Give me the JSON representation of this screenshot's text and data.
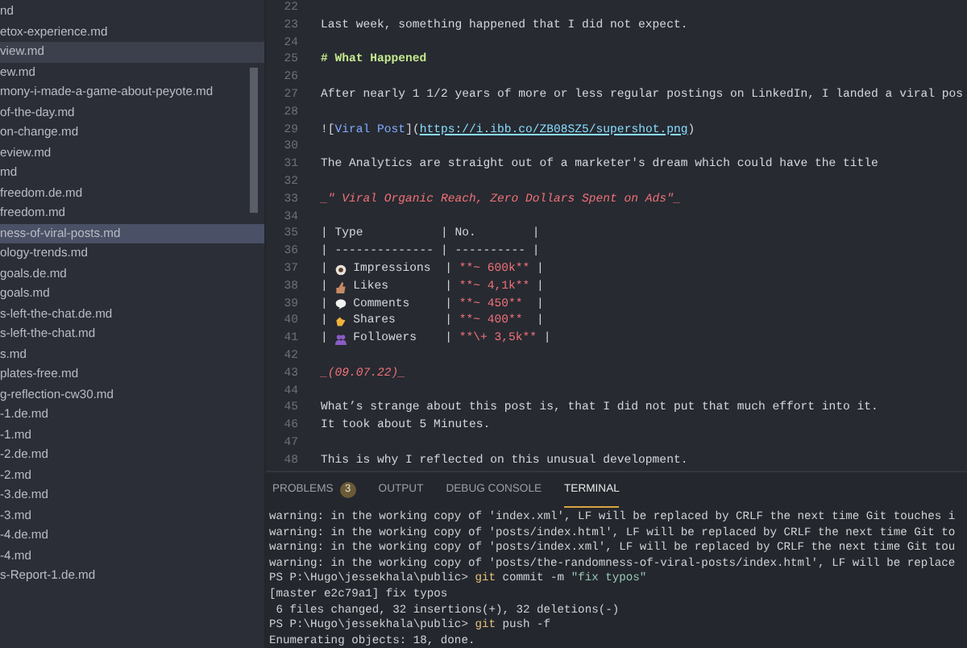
{
  "explorer": {
    "files": [
      {
        "name": "nd",
        "selected": false,
        "hovered": false
      },
      {
        "name": "etox-experience.md",
        "selected": false,
        "hovered": false
      },
      {
        "name": "view.md",
        "selected": false,
        "hovered": true
      },
      {
        "name": "ew.md",
        "selected": false,
        "hovered": false
      },
      {
        "name": "mony-i-made-a-game-about-peyote.md",
        "selected": false,
        "hovered": false
      },
      {
        "name": "of-the-day.md",
        "selected": false,
        "hovered": false
      },
      {
        "name": "on-change.md",
        "selected": false,
        "hovered": false
      },
      {
        "name": "eview.md",
        "selected": false,
        "hovered": false
      },
      {
        "name": "md",
        "selected": false,
        "hovered": false
      },
      {
        "name": "freedom.de.md",
        "selected": false,
        "hovered": false
      },
      {
        "name": "freedom.md",
        "selected": false,
        "hovered": false
      },
      {
        "name": "ness-of-viral-posts.md",
        "selected": true,
        "hovered": false
      },
      {
        "name": "ology-trends.md",
        "selected": false,
        "hovered": false
      },
      {
        "name": "goals.de.md",
        "selected": false,
        "hovered": false
      },
      {
        "name": "goals.md",
        "selected": false,
        "hovered": false
      },
      {
        "name": "s-left-the-chat.de.md",
        "selected": false,
        "hovered": false
      },
      {
        "name": "s-left-the-chat.md",
        "selected": false,
        "hovered": false
      },
      {
        "name": "s.md",
        "selected": false,
        "hovered": false
      },
      {
        "name": "plates-free.md",
        "selected": false,
        "hovered": false
      },
      {
        "name": "g-reflection-cw30.md",
        "selected": false,
        "hovered": false
      },
      {
        "name": "-1.de.md",
        "selected": false,
        "hovered": false
      },
      {
        "name": "-1.md",
        "selected": false,
        "hovered": false
      },
      {
        "name": "-2.de.md",
        "selected": false,
        "hovered": false
      },
      {
        "name": "-2.md",
        "selected": false,
        "hovered": false
      },
      {
        "name": "-3.de.md",
        "selected": false,
        "hovered": false
      },
      {
        "name": "-3.md",
        "selected": false,
        "hovered": false
      },
      {
        "name": "-4.de.md",
        "selected": false,
        "hovered": false
      },
      {
        "name": "-4.md",
        "selected": false,
        "hovered": false
      },
      {
        "name": "s-Report-1.de.md",
        "selected": false,
        "hovered": false
      }
    ]
  },
  "editor": {
    "lines": [
      {
        "number": "22"
      },
      {
        "number": "23",
        "segments": [
          {
            "kind": "plain",
            "text": "Last week, something happened that I did not expect."
          }
        ]
      },
      {
        "number": "24"
      },
      {
        "number": "25",
        "segments": [
          {
            "kind": "heading",
            "text": "# What Happened"
          }
        ]
      },
      {
        "number": "26"
      },
      {
        "number": "27",
        "segments": [
          {
            "kind": "plain",
            "text": "After nearly 1 1/2 years of more or less regular postings on LinkedIn, I landed a viral pos"
          }
        ]
      },
      {
        "number": "28"
      },
      {
        "number": "29",
        "segments": [
          {
            "kind": "plain",
            "text": "!["
          },
          {
            "kind": "link",
            "text": "Viral Post"
          },
          {
            "kind": "plain",
            "text": "]("
          },
          {
            "kind": "url",
            "text": "https://i.ibb.co/ZB08SZ5/supershot.png"
          },
          {
            "kind": "plain",
            "text": ")"
          }
        ]
      },
      {
        "number": "30"
      },
      {
        "number": "31",
        "segments": [
          {
            "kind": "plain",
            "text": "The Analytics are straight out of a marketer's dream which could have the title"
          }
        ]
      },
      {
        "number": "32"
      },
      {
        "number": "33",
        "segments": [
          {
            "kind": "emph",
            "text": "_\" Viral Organic Reach, Zero Dollars Spent on Ads\"_"
          }
        ]
      },
      {
        "number": "34"
      },
      {
        "number": "35",
        "segments": [
          {
            "kind": "plain",
            "text": "| Type           | No.        |"
          }
        ]
      },
      {
        "number": "36",
        "segments": [
          {
            "kind": "plain",
            "text": "| -------------- | ---------- |"
          }
        ]
      },
      {
        "number": "37",
        "segments": [
          {
            "kind": "plain",
            "text": "| "
          },
          {
            "kind": "icon"
          },
          {
            "kind": "plain",
            "text": " Impressions  | "
          },
          {
            "kind": "bold",
            "text": "**~ 600k**"
          },
          {
            "kind": "plain",
            "text": " |"
          }
        ]
      },
      {
        "number": "38",
        "segments": [
          {
            "kind": "plain",
            "text": "| "
          },
          {
            "kind": "icon"
          },
          {
            "kind": "plain",
            "text": " Likes        | "
          },
          {
            "kind": "bold",
            "text": "**~ 4,1k**"
          },
          {
            "kind": "plain",
            "text": " |"
          }
        ]
      },
      {
        "number": "39",
        "segments": [
          {
            "kind": "plain",
            "text": "| "
          },
          {
            "kind": "icon"
          },
          {
            "kind": "plain",
            "text": " Comments     | "
          },
          {
            "kind": "bold",
            "text": "**~ 450**"
          },
          {
            "kind": "plain",
            "text": "  |"
          }
        ]
      },
      {
        "number": "40",
        "segments": [
          {
            "kind": "plain",
            "text": "| "
          },
          {
            "kind": "icon"
          },
          {
            "kind": "plain",
            "text": " Shares       | "
          },
          {
            "kind": "bold",
            "text": "**~ 400**"
          },
          {
            "kind": "plain",
            "text": "  |"
          }
        ]
      },
      {
        "number": "41",
        "segments": [
          {
            "kind": "plain",
            "text": "| "
          },
          {
            "kind": "icon"
          },
          {
            "kind": "plain",
            "text": " Followers    | "
          },
          {
            "kind": "bold",
            "text": "**\\+ 3,5k**"
          },
          {
            "kind": "plain",
            "text": " |"
          }
        ]
      },
      {
        "number": "42"
      },
      {
        "number": "43",
        "segments": [
          {
            "kind": "emph",
            "text": "_(09.07.22)_"
          }
        ]
      },
      {
        "number": "44"
      },
      {
        "number": "45",
        "segments": [
          {
            "kind": "plain",
            "text": "What’s strange about this post is, that I did not put that much effort into it."
          }
        ]
      },
      {
        "number": "46",
        "segments": [
          {
            "kind": "plain",
            "text": "It took about 5 Minutes."
          }
        ]
      },
      {
        "number": "47"
      },
      {
        "number": "48",
        "segments": [
          {
            "kind": "plain",
            "text": "This is why I reflected on this unusual development."
          }
        ]
      }
    ]
  },
  "panel": {
    "tabs": [
      {
        "label": "PROBLEMS",
        "badge": "3",
        "selected": false
      },
      {
        "label": "OUTPUT",
        "selected": false
      },
      {
        "label": "DEBUG CONSOLE",
        "selected": false
      },
      {
        "label": "TERMINAL",
        "selected": true
      }
    ],
    "terminal": [
      [
        {
          "kind": "plain",
          "text": "warning: in the working copy of 'index.xml', LF will be replaced by CRLF the next time Git touches i"
        }
      ],
      [
        {
          "kind": "plain",
          "text": "warning: in the working copy of 'posts/index.html', LF will be replaced by CRLF the next time Git to"
        }
      ],
      [
        {
          "kind": "plain",
          "text": "warning: in the working copy of 'posts/index.xml', LF will be replaced by CRLF the next time Git tou"
        }
      ],
      [
        {
          "kind": "plain",
          "text": "warning: in the working copy of 'posts/the-randomness-of-viral-posts/index.html', LF will be replace"
        }
      ],
      [
        {
          "kind": "plain",
          "text": "PS P:\\Hugo\\jessekhala\\public> "
        },
        {
          "kind": "command",
          "text": "git"
        },
        {
          "kind": "plain",
          "text": " commit -m "
        },
        {
          "kind": "string",
          "text": "\"fix typos\""
        }
      ],
      [
        {
          "kind": "plain",
          "text": "[master e2c79a1] fix typos"
        }
      ],
      [
        {
          "kind": "plain",
          "text": " 6 files changed, 32 insertions(+), 32 deletions(-)"
        }
      ],
      [
        {
          "kind": "plain",
          "text": "PS P:\\Hugo\\jessekhala\\public> "
        },
        {
          "kind": "command",
          "text": "git"
        },
        {
          "kind": "plain",
          "text": " push -f"
        }
      ],
      [
        {
          "kind": "plain",
          "text": "Enumerating objects: 18, done."
        }
      ]
    ]
  }
}
